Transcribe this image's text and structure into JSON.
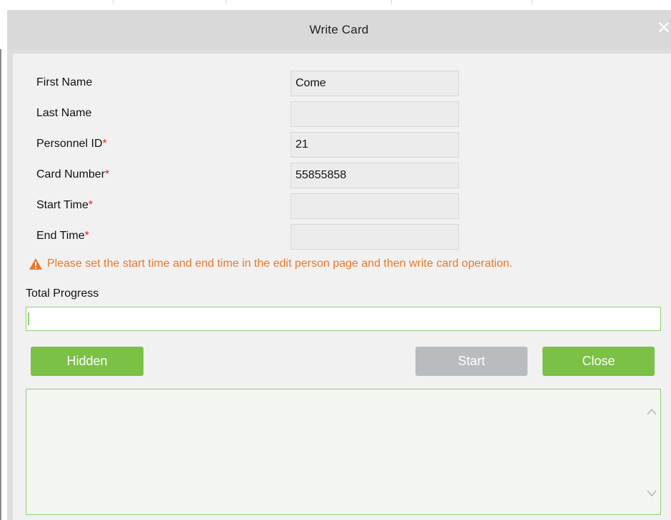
{
  "dialog": {
    "title": "Write Card",
    "close_icon": "close-icon"
  },
  "form": {
    "fields": [
      {
        "label": "First Name",
        "required": false,
        "value": ""
      },
      {
        "label": "Last Name",
        "required": false,
        "value": ""
      },
      {
        "label": "Personnel ID",
        "required": true,
        "value": "21"
      },
      {
        "label": "Card Number",
        "required": true,
        "value": "55855858"
      },
      {
        "label": "Start Time",
        "required": true,
        "value": ""
      },
      {
        "label": "End Time",
        "required": true,
        "value": ""
      }
    ],
    "first_name_value": "Come",
    "required_marker": "*"
  },
  "warning": {
    "icon": "warning-icon",
    "text": "Please set the start time and end time in the edit person page and then write card operation."
  },
  "progress": {
    "label": "Total Progress",
    "percent": 0
  },
  "buttons": {
    "hidden": "Hidden",
    "start": "Start",
    "close": "Close"
  },
  "colors": {
    "accent_green": "#7ac145",
    "warning_orange": "#e8782a",
    "required_red": "#e02020",
    "disabled_gray": "#b8bcbf"
  },
  "log": {
    "content": ""
  }
}
